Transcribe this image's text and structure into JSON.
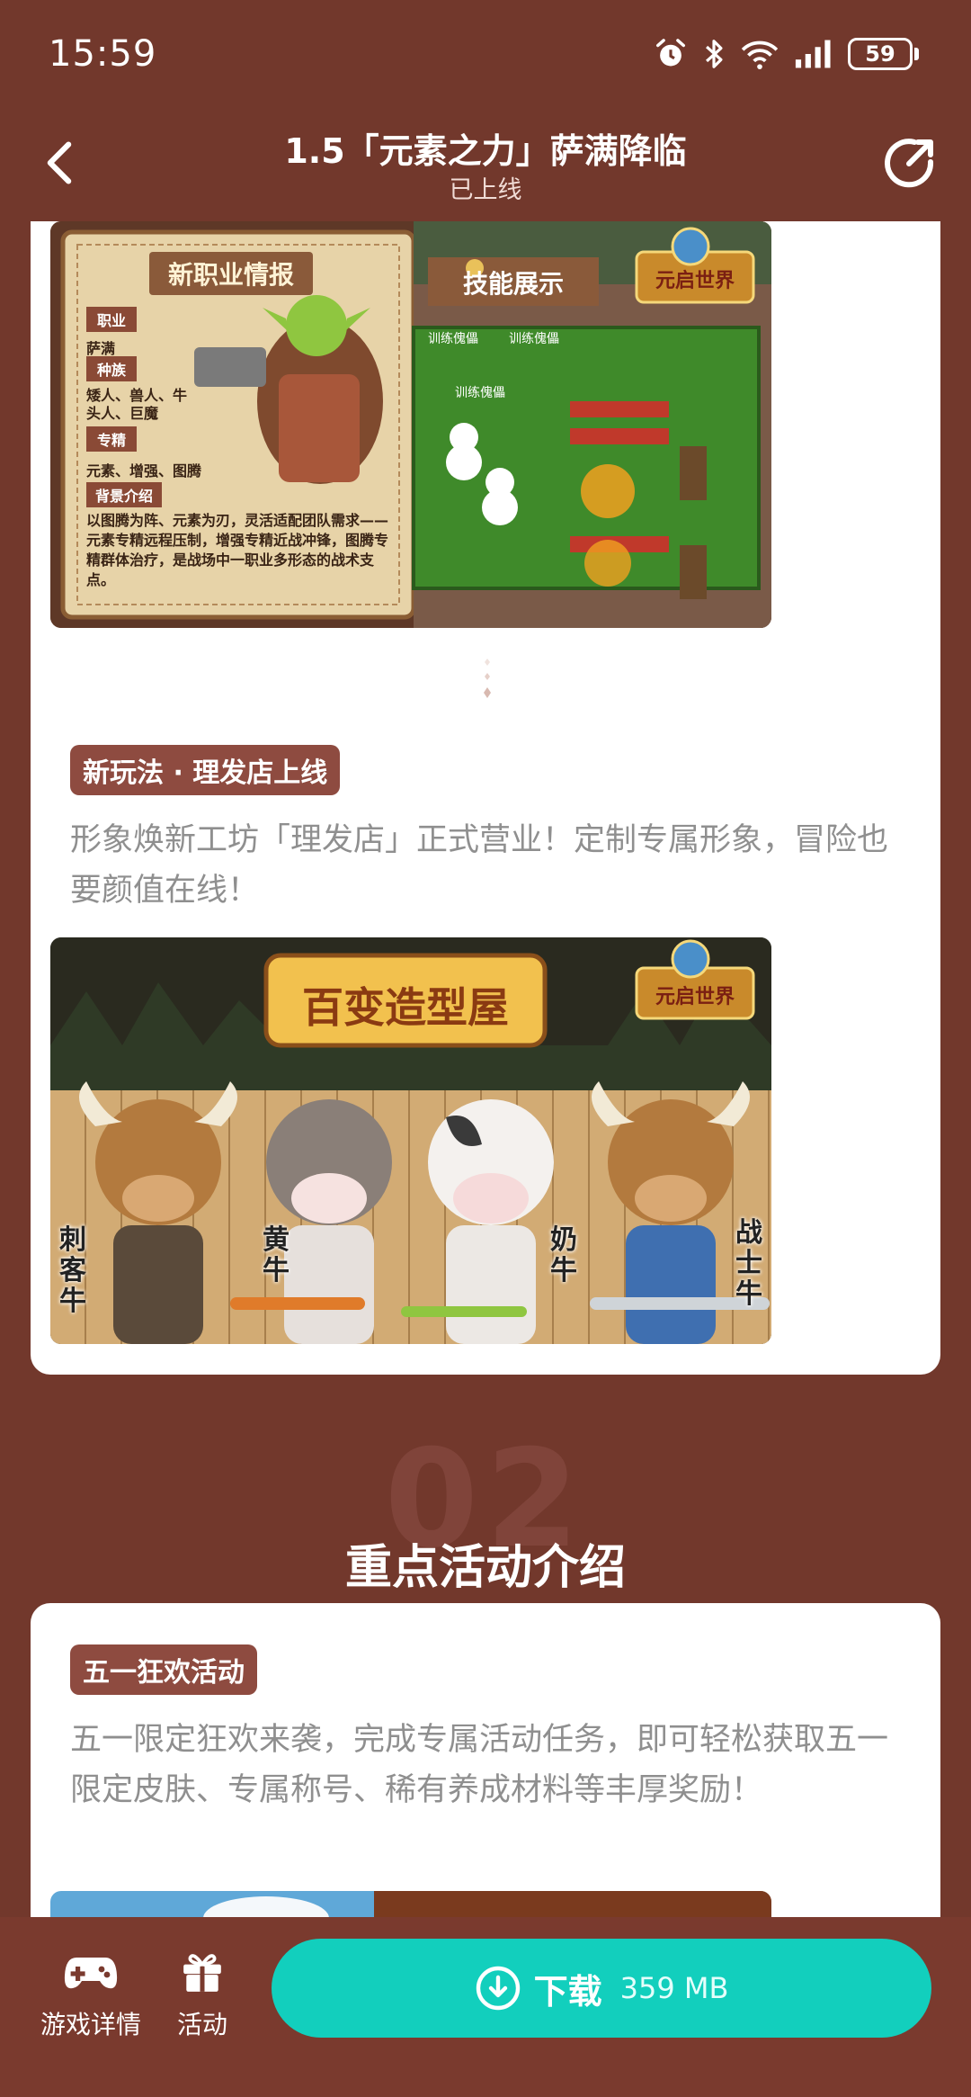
{
  "status_bar": {
    "time": "15:59",
    "battery": "59",
    "icons": [
      "alarm-icon",
      "bluetooth-icon",
      "wifi-icon",
      "signal-icon",
      "battery-icon"
    ]
  },
  "header": {
    "title": "1.5「元素之力」萨满降临",
    "subtitle": "已上线",
    "back_icon": "chevron-left-icon",
    "share_icon": "share-icon"
  },
  "card1": {
    "image1": {
      "panel_title": "新职业情报",
      "skill_title": "技能展示",
      "logo": "元启世界",
      "info": [
        {
          "label": "职业",
          "text": "萨满"
        },
        {
          "label": "种族",
          "text": "矮人、兽人、牛头人、巨魔"
        },
        {
          "label": "专精",
          "text": "元素、增强、图腾"
        },
        {
          "label": "背景介绍",
          "text": "以图腾为阵、元素为刃，灵活适配团队需求——元素专精远程压制，增强专精近战冲锋，图腾专精群体治疗，是战场中一职业多形态的战术支点。"
        }
      ],
      "dummies": [
        "训练傀儡",
        "训练傀儡",
        "训练傀儡"
      ]
    },
    "section2": {
      "tag": "新玩法 · 理发店上线",
      "text": "形象焕新工坊「理发店」正式营业！定制专属形象，冒险也要颜值在线！"
    },
    "image2": {
      "title": "百变造型屋",
      "logo": "元启世界",
      "cows": [
        "刺客牛",
        "黄牛",
        "奶牛",
        "战士牛"
      ]
    }
  },
  "section_heading": {
    "number": "02",
    "title": "重点活动介绍"
  },
  "card2": {
    "tag": "五一狂欢活动",
    "text": "五一限定狂欢来袭，完成专属活动任务，即可轻松获取五一限定皮肤、专属称号、稀有养成材料等丰厚奖励！"
  },
  "bottom_bar": {
    "games_label": "游戏详情",
    "activity_label": "活动",
    "download_label": "下载",
    "download_size": "359 MB"
  },
  "colors": {
    "background": "#72382c",
    "tag": "#8e4b40",
    "download": "#12cfbd"
  }
}
